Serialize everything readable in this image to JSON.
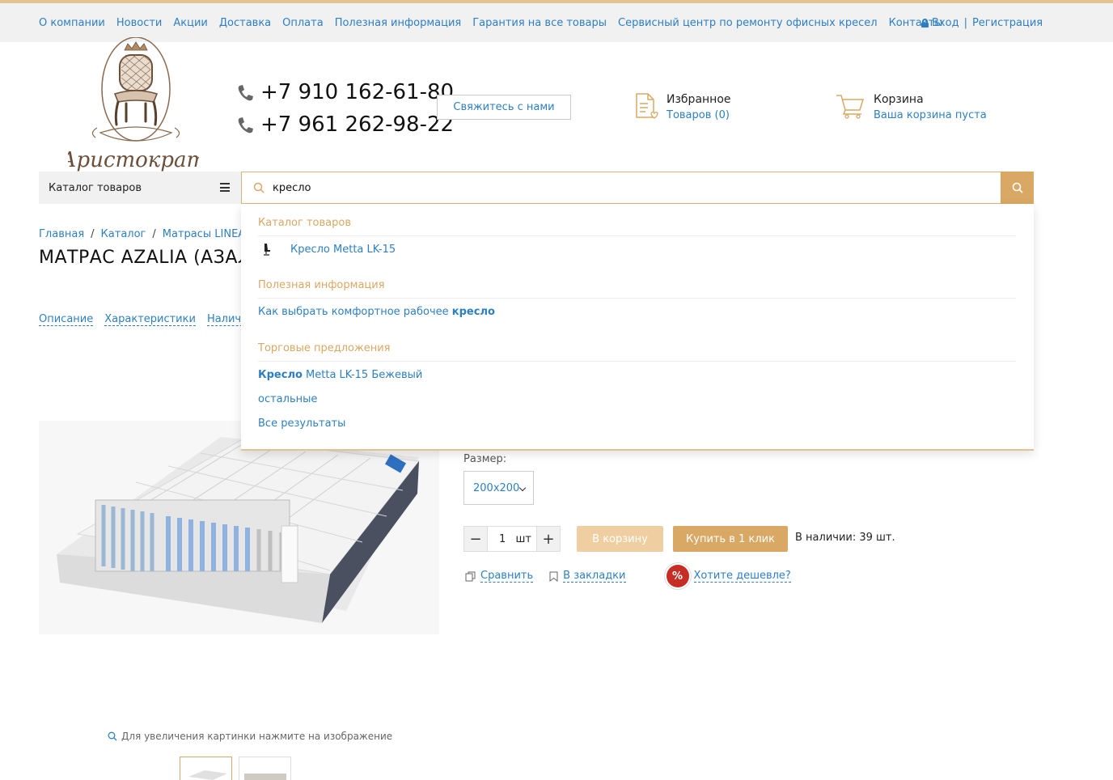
{
  "topnav": {
    "items": [
      "О компании",
      "Новости",
      "Акции",
      "Доставка",
      "Оплата",
      "Полезная информация",
      "Гарантия на все товары",
      "Сервисный центр по ремонту офисных кресел",
      "Контакты"
    ],
    "login": "Вход",
    "register": "Регистрация"
  },
  "header": {
    "logo_text": "Аристократ",
    "phones": [
      "+7 910 162-61-80",
      "+7 961 262-98-22"
    ],
    "contact_button": "Свяжитесь с нами",
    "favorites_title": "Избранное",
    "favorites_count": "Товаров (0)",
    "cart_title": "Корзина",
    "cart_status": "Ваша корзина пуста"
  },
  "catalog": {
    "label": "Каталог товаров"
  },
  "search": {
    "value": "кресло"
  },
  "dropdown": {
    "sections": [
      {
        "title": "Каталог товаров",
        "items": [
          {
            "bold": "",
            "text": "Кресло Metta LK-15"
          }
        ]
      },
      {
        "title": "Полезная информация",
        "items": [
          {
            "text": "Как выбрать комфортное рабочее ",
            "bold": "кресло"
          }
        ]
      },
      {
        "title": "Торговые предложения",
        "items": [
          {
            "bold": "Кресло",
            "text": " Metta LK-15 Бежевый"
          }
        ]
      }
    ],
    "others": "остальные",
    "all_results": "Все результаты"
  },
  "breadcrumb": [
    "Главная",
    "Каталог",
    "Матрасы LINEAR"
  ],
  "page_title": "МАТРАС AZALIA (АЗАЛ",
  "tabs": [
    "Описание",
    "Характеристики",
    "Наличие"
  ],
  "product": {
    "size_label": "Размер:",
    "size_value": "200x200",
    "qty": "1",
    "unit": "шт",
    "cart_button": "В корзину",
    "buy_button": "Купить в 1 клик",
    "stock": "В наличии: 39 шт.",
    "compare": "Сравнить",
    "bookmark": "В закладки",
    "cheaper": "Хотите дешевле?",
    "zoom_hint": "Для увеличения картинки нажмите на изображение"
  },
  "colors": {
    "accent": "#d9a865",
    "link": "#2e7fc2",
    "discount": "#c62d24"
  }
}
